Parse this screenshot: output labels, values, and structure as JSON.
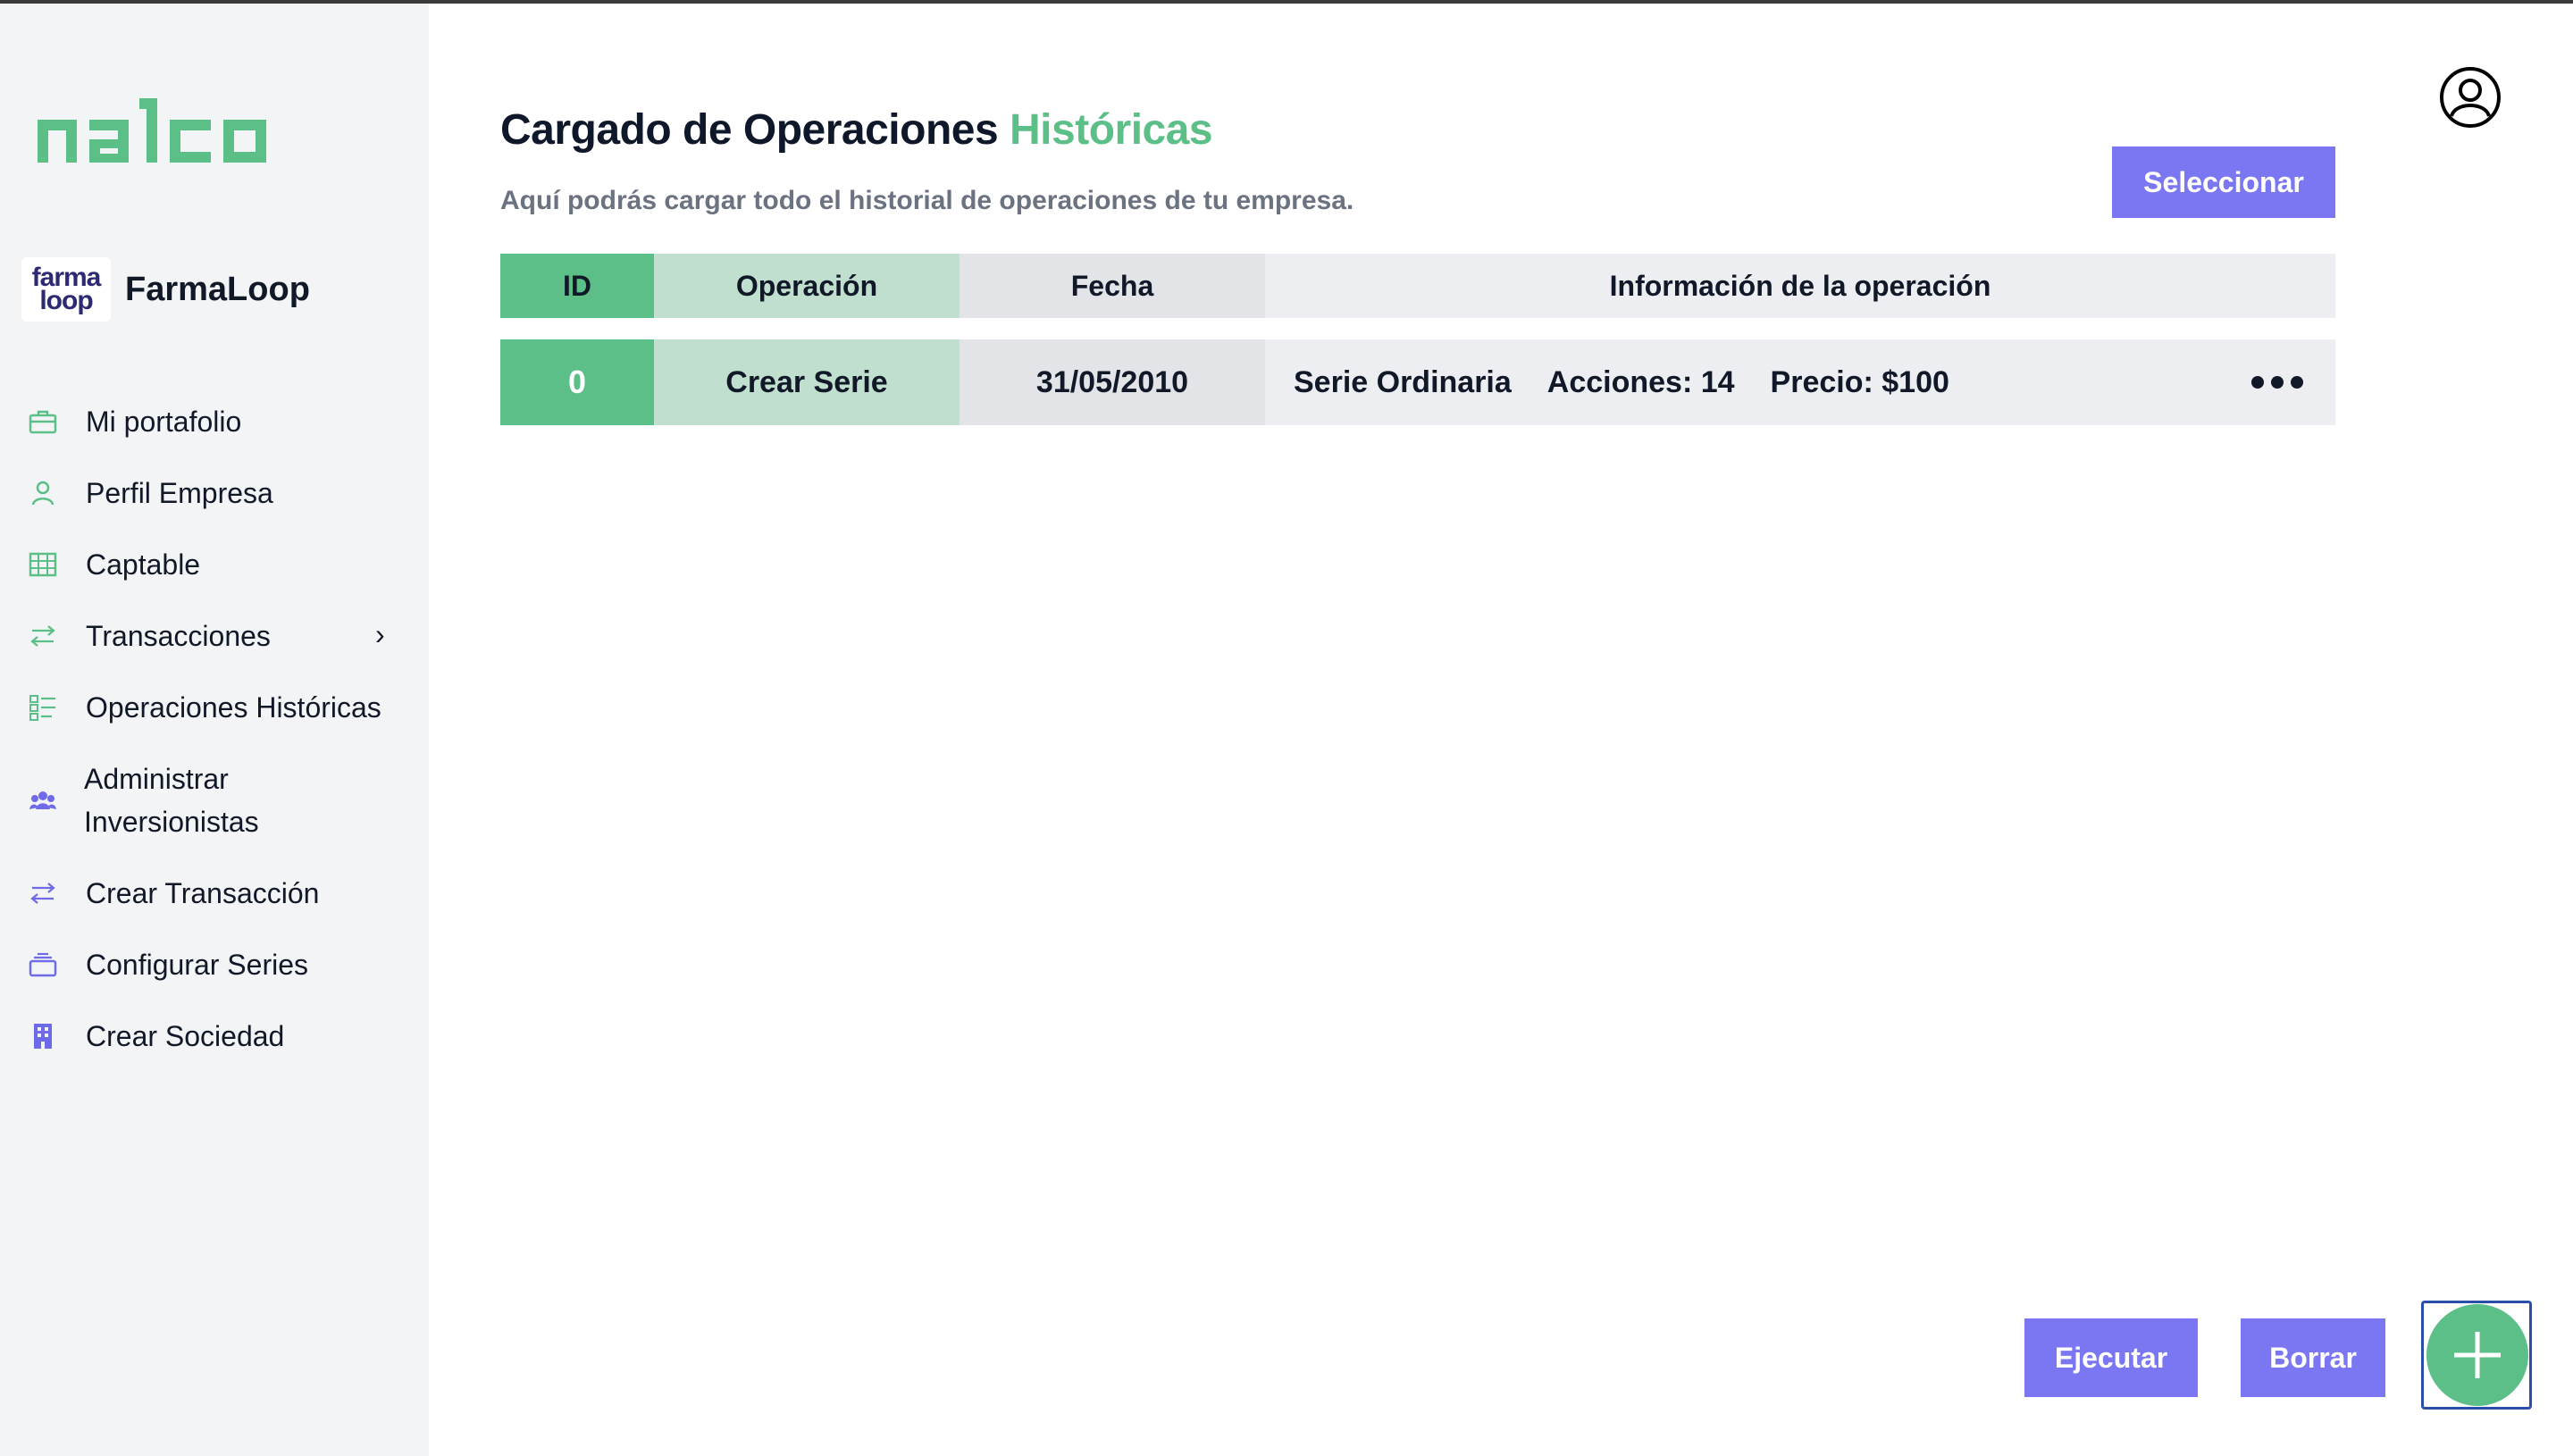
{
  "app": {
    "brand": "nalco",
    "company_name": "FarmaLoop",
    "company_logo_line1": "farma",
    "company_logo_line2": "loop"
  },
  "sidebar": {
    "items": [
      {
        "label": "Mi portafolio",
        "icon": "briefcase-icon"
      },
      {
        "label": "Perfil Empresa",
        "icon": "user-icon"
      },
      {
        "label": "Captable",
        "icon": "table-icon"
      },
      {
        "label": "Transacciones",
        "icon": "arrows-icon",
        "has_submenu": true
      },
      {
        "label": "Operaciones Históricas",
        "icon": "checklist-icon"
      },
      {
        "label": "Administrar Inversionistas",
        "icon": "users-icon"
      },
      {
        "label": "Crear Transacción",
        "icon": "arrows-icon"
      },
      {
        "label": "Configurar Series",
        "icon": "layers-icon"
      },
      {
        "label": "Crear Sociedad",
        "icon": "building-icon"
      }
    ],
    "chevron": "›"
  },
  "header": {
    "title_main": "Cargado de Operaciones",
    "title_accent": "Históricas",
    "subtitle": "Aquí podrás cargar todo el historial de operaciones de tu empresa.",
    "select_button": "Seleccionar"
  },
  "table": {
    "columns": [
      "ID",
      "Operación",
      "Fecha",
      "Información de la operación"
    ],
    "rows": [
      {
        "id": "0",
        "operation": "Crear Serie",
        "date": "31/05/2010",
        "info_serie": "Serie Ordinaria",
        "info_acciones": "Acciones: 14",
        "info_precio": "Precio: $100"
      }
    ]
  },
  "actions": {
    "run_label": "Ejecutar",
    "delete_label": "Borrar"
  },
  "colors": {
    "accent_green": "#5cbf87",
    "button_purple": "#7b76f1",
    "sidebar_bg": "#f3f4f6"
  }
}
